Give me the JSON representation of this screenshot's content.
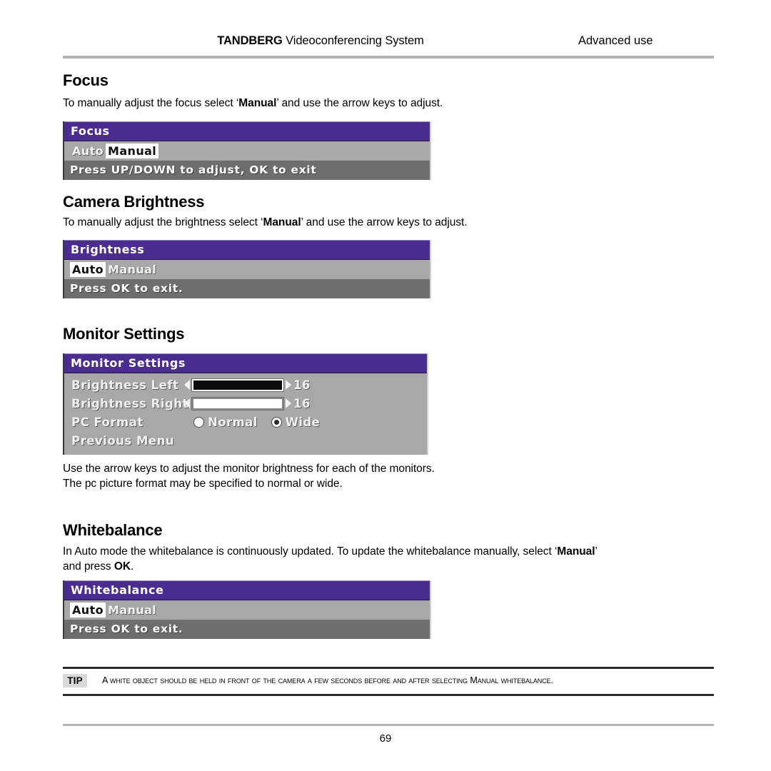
{
  "header": {
    "title_brand": "TANDBERG",
    "title_rest": " Videoconferencing System",
    "section": "Advanced use"
  },
  "sections": {
    "focus": {
      "heading": "Focus",
      "body_prefix": "To manually adjust the focus select ‘",
      "body_bold": "Manual",
      "body_suffix": "’ and use the arrow keys to adjust.",
      "menu": {
        "title": "Focus",
        "options": [
          {
            "label": "Auto",
            "selected": false
          },
          {
            "label": "Manual",
            "selected": true
          }
        ],
        "footer": "Press UP/DOWN to adjust, OK to exit"
      }
    },
    "camera_brightness": {
      "heading": "Camera Brightness",
      "body_prefix": "To manually adjust the brightness select ‘",
      "body_bold": "Manual",
      "body_suffix": "’ and use the arrow keys to adjust.",
      "menu": {
        "title": "Brightness",
        "options": [
          {
            "label": "Auto",
            "selected": true
          },
          {
            "label": "Manual",
            "selected": false
          }
        ],
        "footer": "Press OK to exit."
      }
    },
    "monitor_settings": {
      "heading": "Monitor Settings",
      "menu": {
        "title": "Monitor Settings",
        "rows": [
          {
            "label": "Brightness Left",
            "value": "16",
            "fill": "dark"
          },
          {
            "label": "Brightness Right",
            "value": "16",
            "fill": "light"
          }
        ],
        "pc_format_label": "PC Format",
        "pc_format_options": [
          {
            "label": "Normal",
            "selected": false
          },
          {
            "label": "Wide",
            "selected": true
          }
        ],
        "previous_menu": "Previous Menu"
      },
      "body_line1": "Use the arrow keys to adjust the monitor brightness for each of the monitors.",
      "body_line2": "The pc picture format may be specified to normal or wide."
    },
    "whitebalance": {
      "heading": "Whitebalance",
      "body_prefix": "In Auto mode the whitebalance is continuously updated. To update the whitebalance manually, select ‘",
      "body_bold": "Manual",
      "body_mid": "’",
      "body_line2_prefix": "and press ",
      "body_line2_bold": "OK",
      "body_line2_suffix": ".",
      "menu": {
        "title": "Whitebalance",
        "options": [
          {
            "label": "Auto",
            "selected": true
          },
          {
            "label": "Manual",
            "selected": false
          }
        ],
        "footer": "Press OK to exit."
      }
    }
  },
  "tip": {
    "badge": "TIP",
    "text": "A white object should be held in front of the camera a few seconds before and after selecting Manual whitebalance."
  },
  "footer": {
    "page_number": "69"
  },
  "colors": {
    "menu_title_bg": "#4b2d8f",
    "menu_option_bg": "#a8a8a8",
    "menu_footer_bg": "#6e6e6e",
    "rule_gray": "#b5b5b5",
    "rule_dark": "#2b2b2b"
  }
}
